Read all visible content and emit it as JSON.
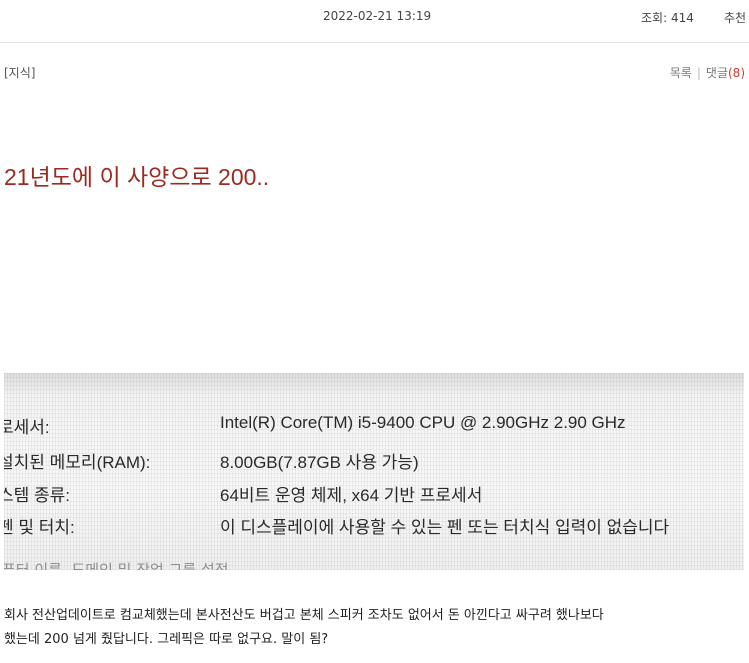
{
  "meta": {
    "date": "2022-02-21 13:19",
    "views": "조회: 414",
    "recommend": "추천"
  },
  "post": {
    "category": "[지식]",
    "list_label": "목록",
    "comment_label": "댓글",
    "comment_count": "(8)",
    "title": "21년도에 이 사양으로 200..",
    "photo": {
      "rows": [
        {
          "label": "로세서:",
          "value": "Intel(R) Core(TM) i5-9400 CPU @ 2.90GHz   2.90 GHz"
        },
        {
          "label": "설치된 메모리(RAM):",
          "value": "8.00GB(7.87GB 사용 가능)"
        },
        {
          "label": "스템 종류:",
          "value": "64비트 운영 체제, x64 기반 프로세서"
        },
        {
          "label": "펜 및 터치:",
          "value": "이 디스플레이에 사용할 수 있는 펜 또는 터치식 입력이 없습니다"
        }
      ],
      "cut_text": "퓨터 이름, 도메인 및 작업 그룹 설정"
    },
    "body_line1": "회사 전산업데이트로 컴교체했는데 본사전산도 버겁고 본체 스피커 조차도 없어서 돈 아낀다고 싸구려 했나보다",
    "body_line2": "했는데 200  넘게 줬답니다. 그레픽은 따로 없구요. 말이 됨?"
  }
}
